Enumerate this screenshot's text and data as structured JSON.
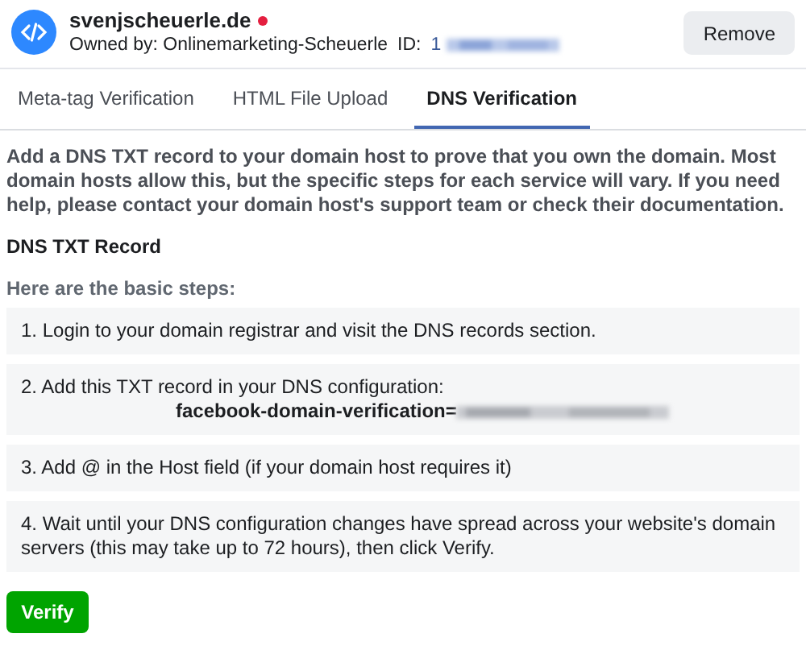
{
  "site": {
    "domain": "svenjscheuerle.de",
    "owner": "Owned by: Onlinemarketing-Scheuerle",
    "id_label": "ID:",
    "id_prefix": "1"
  },
  "remove_button": "Remove",
  "tabs": [
    {
      "label": "Meta-tag Verification",
      "selected": false
    },
    {
      "label": "HTML File Upload",
      "selected": false
    },
    {
      "label": "DNS Verification",
      "selected": true
    }
  ],
  "intro": "Add a DNS TXT record to your domain host to prove that you own the domain. Most domain hosts allow this, but the specific steps for each service will vary. If you need help, please contact your domain host's support team or check their documentation.",
  "section_title": "DNS TXT Record",
  "steps_intro": "Here are the basic steps:",
  "steps": [
    {
      "kind": "text",
      "text": "1. Login to your domain registrar and visit the DNS records section."
    },
    {
      "kind": "record",
      "text": "2. Add this TXT record in your DNS configuration:",
      "record": "facebook-domain-verification="
    },
    {
      "kind": "text",
      "text": "3. Add @ in the Host field (if your domain host requires it)"
    },
    {
      "kind": "text",
      "text": "4. Wait until your DNS configuration changes have spread across your website's domain servers (this may take up to 72 hours), then click Verify."
    }
  ],
  "verify_button": "Verify"
}
